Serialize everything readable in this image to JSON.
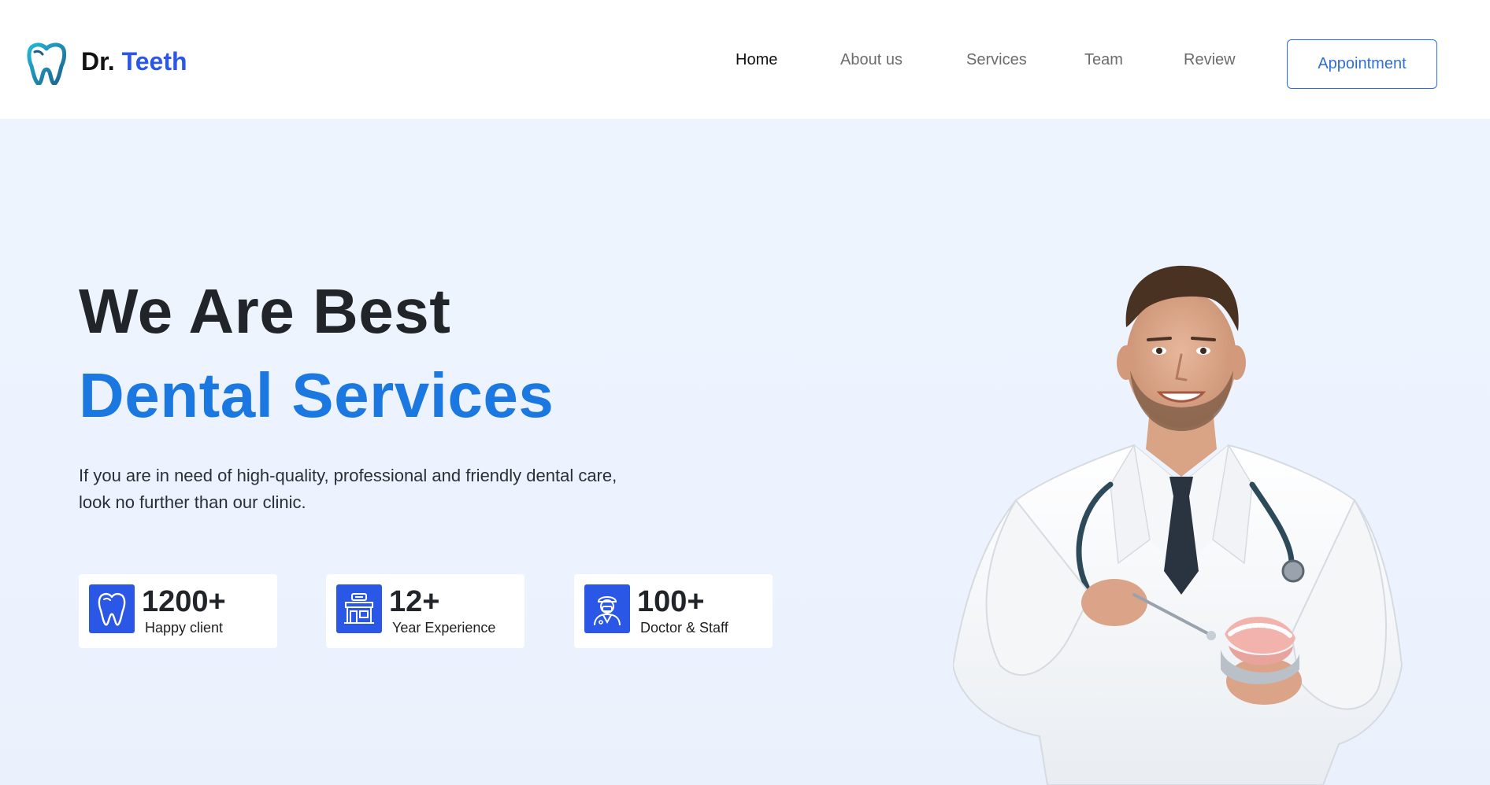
{
  "brand": {
    "prefix": "Dr.",
    "name": "Teeth"
  },
  "nav": {
    "items": [
      {
        "label": "Home",
        "active": true
      },
      {
        "label": "About us",
        "active": false
      },
      {
        "label": "Services",
        "active": false
      },
      {
        "label": "Team",
        "active": false
      },
      {
        "label": "Review",
        "active": false
      }
    ],
    "cta_label": "Appointment"
  },
  "hero": {
    "title_line1": "We Are Best",
    "title_line2": "Dental Services",
    "description_line1": "If you are in need of high-quality, professional and friendly dental care,",
    "description_line2": "look no further than our clinic."
  },
  "stats": [
    {
      "value": "1200+",
      "label": "Happy client",
      "icon": "tooth-icon"
    },
    {
      "value": "12+",
      "label": "Year Experience",
      "icon": "clinic-icon"
    },
    {
      "value": "100+",
      "label": "Doctor & Staff",
      "icon": "doctor-icon"
    }
  ],
  "colors": {
    "accent": "#2b57e6",
    "title_blue": "#1b78e0",
    "button_outline": "#2f6fd6",
    "hero_bg": "#eef4fe",
    "text_dark": "#212529"
  }
}
